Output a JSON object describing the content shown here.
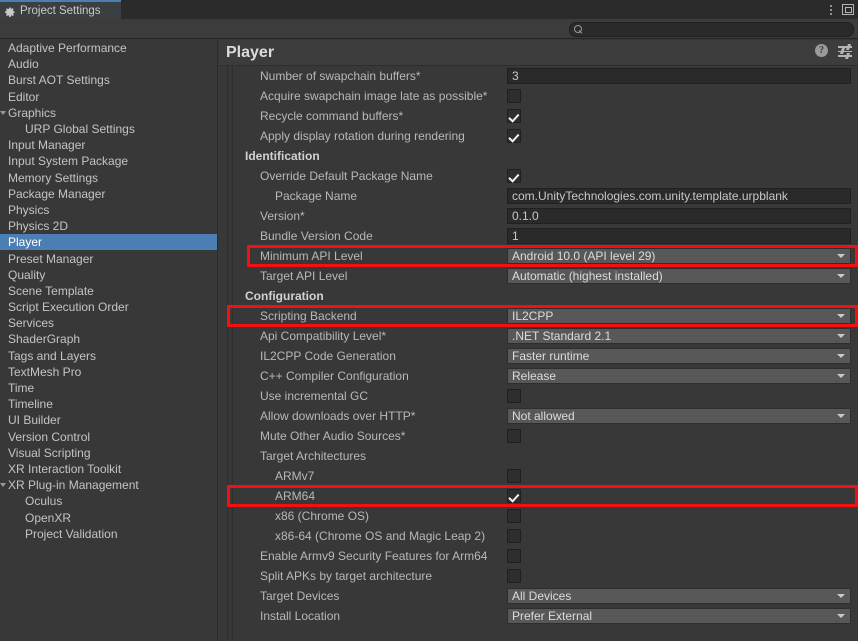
{
  "window": {
    "tab_label": "Project Settings",
    "gear_icon": "gear-icon",
    "kebab_icon": "more-options-icon",
    "maximize_icon": "maximize-window-icon"
  },
  "toolbar": {
    "search_value": "",
    "search_placeholder": "",
    "search_icon": "search-icon"
  },
  "sidebar": {
    "items": [
      {
        "label": "Adaptive Performance",
        "indent": 0,
        "foldout": false,
        "selected": false
      },
      {
        "label": "Audio",
        "indent": 0,
        "foldout": false,
        "selected": false
      },
      {
        "label": "Burst AOT Settings",
        "indent": 0,
        "foldout": false,
        "selected": false
      },
      {
        "label": "Editor",
        "indent": 0,
        "foldout": false,
        "selected": false
      },
      {
        "label": "Graphics",
        "indent": 0,
        "foldout": true,
        "selected": false
      },
      {
        "label": "URP Global Settings",
        "indent": 1,
        "foldout": false,
        "selected": false
      },
      {
        "label": "Input Manager",
        "indent": 0,
        "foldout": false,
        "selected": false
      },
      {
        "label": "Input System Package",
        "indent": 0,
        "foldout": false,
        "selected": false
      },
      {
        "label": "Memory Settings",
        "indent": 0,
        "foldout": false,
        "selected": false
      },
      {
        "label": "Package Manager",
        "indent": 0,
        "foldout": false,
        "selected": false
      },
      {
        "label": "Physics",
        "indent": 0,
        "foldout": false,
        "selected": false
      },
      {
        "label": "Physics 2D",
        "indent": 0,
        "foldout": false,
        "selected": false
      },
      {
        "label": "Player",
        "indent": 0,
        "foldout": false,
        "selected": true
      },
      {
        "label": "Preset Manager",
        "indent": 0,
        "foldout": false,
        "selected": false
      },
      {
        "label": "Quality",
        "indent": 0,
        "foldout": false,
        "selected": false
      },
      {
        "label": "Scene Template",
        "indent": 0,
        "foldout": false,
        "selected": false
      },
      {
        "label": "Script Execution Order",
        "indent": 0,
        "foldout": false,
        "selected": false
      },
      {
        "label": "Services",
        "indent": 0,
        "foldout": false,
        "selected": false
      },
      {
        "label": "ShaderGraph",
        "indent": 0,
        "foldout": false,
        "selected": false
      },
      {
        "label": "Tags and Layers",
        "indent": 0,
        "foldout": false,
        "selected": false
      },
      {
        "label": "TextMesh Pro",
        "indent": 0,
        "foldout": false,
        "selected": false
      },
      {
        "label": "Time",
        "indent": 0,
        "foldout": false,
        "selected": false
      },
      {
        "label": "Timeline",
        "indent": 0,
        "foldout": false,
        "selected": false
      },
      {
        "label": "UI Builder",
        "indent": 0,
        "foldout": false,
        "selected": false
      },
      {
        "label": "Version Control",
        "indent": 0,
        "foldout": false,
        "selected": false
      },
      {
        "label": "Visual Scripting",
        "indent": 0,
        "foldout": false,
        "selected": false
      },
      {
        "label": "XR Interaction Toolkit",
        "indent": 0,
        "foldout": false,
        "selected": false
      },
      {
        "label": "XR Plug-in Management",
        "indent": 0,
        "foldout": true,
        "selected": false
      },
      {
        "label": "Oculus",
        "indent": 1,
        "foldout": false,
        "selected": false
      },
      {
        "label": "OpenXR",
        "indent": 1,
        "foldout": false,
        "selected": false
      },
      {
        "label": "Project Validation",
        "indent": 1,
        "foldout": false,
        "selected": false
      }
    ]
  },
  "panel": {
    "title": "Player",
    "help_icon": "help-icon",
    "help_glyph": "?",
    "preset_icon": "preset-sliders-icon"
  },
  "settings": {
    "rows": [
      {
        "type": "text",
        "label": "Number of swapchain buffers*",
        "indent": 1,
        "value": "3"
      },
      {
        "type": "checkbox",
        "label": "Acquire swapchain image late as possible*",
        "indent": 1,
        "checked": false
      },
      {
        "type": "checkbox",
        "label": "Recycle command buffers*",
        "indent": 1,
        "checked": true
      },
      {
        "type": "checkbox",
        "label": "Apply display rotation during rendering",
        "indent": 1,
        "checked": true
      },
      {
        "type": "section",
        "label": "Identification"
      },
      {
        "type": "checkbox",
        "label": "Override Default Package Name",
        "indent": 1,
        "checked": true
      },
      {
        "type": "text",
        "label": "Package Name",
        "indent": 2,
        "value": "com.UnityTechnologies.com.unity.template.urpblank"
      },
      {
        "type": "text",
        "label": "Version*",
        "indent": 1,
        "value": "0.1.0"
      },
      {
        "type": "text",
        "label": "Bundle Version Code",
        "indent": 1,
        "value": "1"
      },
      {
        "type": "dropdown",
        "label": "Minimum API Level",
        "indent": 1,
        "value": "Android 10.0 (API level 29)",
        "highlighted": true
      },
      {
        "type": "dropdown",
        "label": "Target API Level",
        "indent": 1,
        "value": "Automatic (highest installed)"
      },
      {
        "type": "section",
        "label": "Configuration"
      },
      {
        "type": "dropdown",
        "label": "Scripting Backend",
        "indent": 1,
        "value": "IL2CPP",
        "highlighted": true
      },
      {
        "type": "dropdown",
        "label": "Api Compatibility Level*",
        "indent": 1,
        "value": ".NET Standard 2.1"
      },
      {
        "type": "dropdown",
        "label": "IL2CPP Code Generation",
        "indent": 1,
        "value": "Faster runtime"
      },
      {
        "type": "dropdown",
        "label": "C++ Compiler Configuration",
        "indent": 1,
        "value": "Release"
      },
      {
        "type": "checkbox",
        "label": "Use incremental GC",
        "indent": 1,
        "checked": false
      },
      {
        "type": "dropdown",
        "label": "Allow downloads over HTTP*",
        "indent": 1,
        "value": "Not allowed"
      },
      {
        "type": "checkbox",
        "label": "Mute Other Audio Sources*",
        "indent": 1,
        "checked": false
      },
      {
        "type": "plain",
        "label": "Target Architectures",
        "indent": 1
      },
      {
        "type": "checkbox",
        "label": "ARMv7",
        "indent": 2,
        "checked": false
      },
      {
        "type": "checkbox",
        "label": "ARM64",
        "indent": 2,
        "checked": true,
        "highlighted": true
      },
      {
        "type": "checkbox",
        "label": "x86 (Chrome OS)",
        "indent": 2,
        "checked": false
      },
      {
        "type": "checkbox",
        "label": "x86-64 (Chrome OS and Magic Leap 2)",
        "indent": 2,
        "checked": false
      },
      {
        "type": "checkbox",
        "label": "Enable Armv9 Security Features for Arm64",
        "indent": 1,
        "checked": false
      },
      {
        "type": "checkbox",
        "label": "Split APKs by target architecture",
        "indent": 1,
        "checked": false
      },
      {
        "type": "dropdown",
        "label": "Target Devices",
        "indent": 1,
        "value": "All Devices"
      },
      {
        "type": "dropdown",
        "label": "Install Location",
        "indent": 1,
        "value": "Prefer External"
      }
    ]
  },
  "annotations": {
    "highlight_color": "#f41010",
    "boxes": [
      {
        "target": "Minimum API Level"
      },
      {
        "target": "Scripting Backend"
      },
      {
        "target": "ARM64"
      }
    ]
  }
}
